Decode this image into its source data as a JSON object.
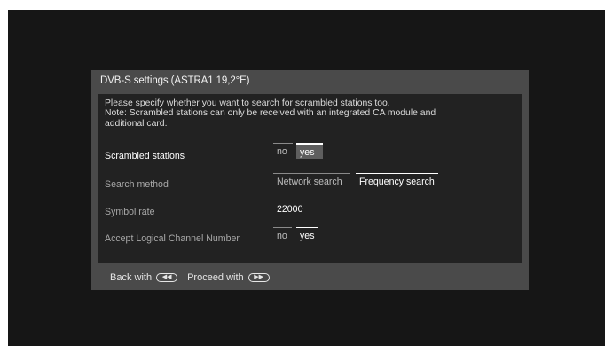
{
  "dialog": {
    "title": "DVB-S settings (ASTRA1 19,2°E)",
    "intro": [
      "Please specify whether you want to search for scrambled stations too.",
      "Note: Scrambled stations can only be received with an integrated CA module and",
      "additional card."
    ]
  },
  "rows": {
    "scrambled": {
      "label": "Scrambled stations",
      "options": [
        "no",
        "yes"
      ],
      "selected": "yes"
    },
    "search_method": {
      "label": "Search method",
      "options": [
        "Network search",
        "Frequency search"
      ],
      "selected": "Frequency search"
    },
    "symbol_rate": {
      "label": "Symbol rate",
      "value": "22000"
    },
    "lcn": {
      "label": "Accept Logical Channel Number",
      "options": [
        "no",
        "yes"
      ],
      "selected": "yes"
    }
  },
  "footer": {
    "back_label": "Back with",
    "back_icon": "rewind-button-icon",
    "proceed_label": "Proceed with",
    "proceed_icon": "fast-forward-button-icon"
  }
}
